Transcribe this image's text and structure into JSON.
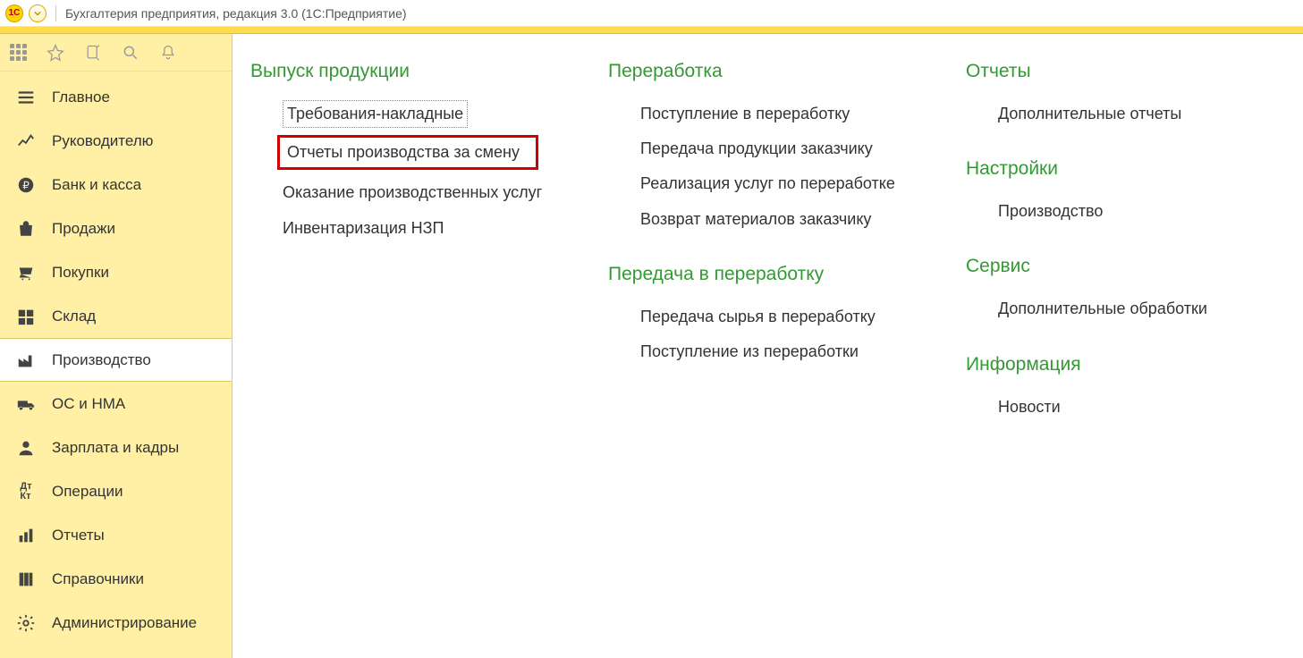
{
  "header": {
    "logo_text": "1C",
    "title": "Бухгалтерия предприятия, редакция 3.0   (1С:Предприятие)"
  },
  "sidebar": {
    "items": [
      {
        "label": "Главное",
        "icon": "menu"
      },
      {
        "label": "Руководителю",
        "icon": "chart"
      },
      {
        "label": "Банк и касса",
        "icon": "coin"
      },
      {
        "label": "Продажи",
        "icon": "bag"
      },
      {
        "label": "Покупки",
        "icon": "cart"
      },
      {
        "label": "Склад",
        "icon": "boxes"
      },
      {
        "label": "Производство",
        "icon": "factory",
        "active": true
      },
      {
        "label": "ОС и НМА",
        "icon": "truck"
      },
      {
        "label": "Зарплата и кадры",
        "icon": "person"
      },
      {
        "label": "Операции",
        "icon": "dtKt"
      },
      {
        "label": "Отчеты",
        "icon": "bars"
      },
      {
        "label": "Справочники",
        "icon": "books"
      },
      {
        "label": "Администрирование",
        "icon": "gear"
      }
    ]
  },
  "content": {
    "col1": {
      "sections": [
        {
          "title": "Выпуск продукции",
          "links": [
            {
              "label": "Требования-накладные",
              "style": "dotted"
            },
            {
              "label": "Отчеты производства за смену",
              "style": "highlighted"
            },
            {
              "label": "Оказание производственных услуг"
            },
            {
              "label": "Инвентаризация НЗП"
            }
          ]
        }
      ]
    },
    "col2": {
      "sections": [
        {
          "title": "Переработка",
          "links": [
            {
              "label": "Поступление в переработку"
            },
            {
              "label": "Передача продукции заказчику"
            },
            {
              "label": "Реализация услуг по переработке"
            },
            {
              "label": "Возврат материалов заказчику"
            }
          ]
        },
        {
          "title": "Передача в переработку",
          "links": [
            {
              "label": "Передача сырья в переработку"
            },
            {
              "label": "Поступление из переработки"
            }
          ]
        }
      ]
    },
    "col3": {
      "sections": [
        {
          "title": "Отчеты",
          "links": [
            {
              "label": "Дополнительные отчеты"
            }
          ]
        },
        {
          "title": "Настройки",
          "links": [
            {
              "label": "Производство"
            }
          ]
        },
        {
          "title": "Сервис",
          "links": [
            {
              "label": "Дополнительные обработки"
            }
          ]
        },
        {
          "title": "Информация",
          "links": [
            {
              "label": "Новости"
            }
          ]
        }
      ]
    }
  }
}
